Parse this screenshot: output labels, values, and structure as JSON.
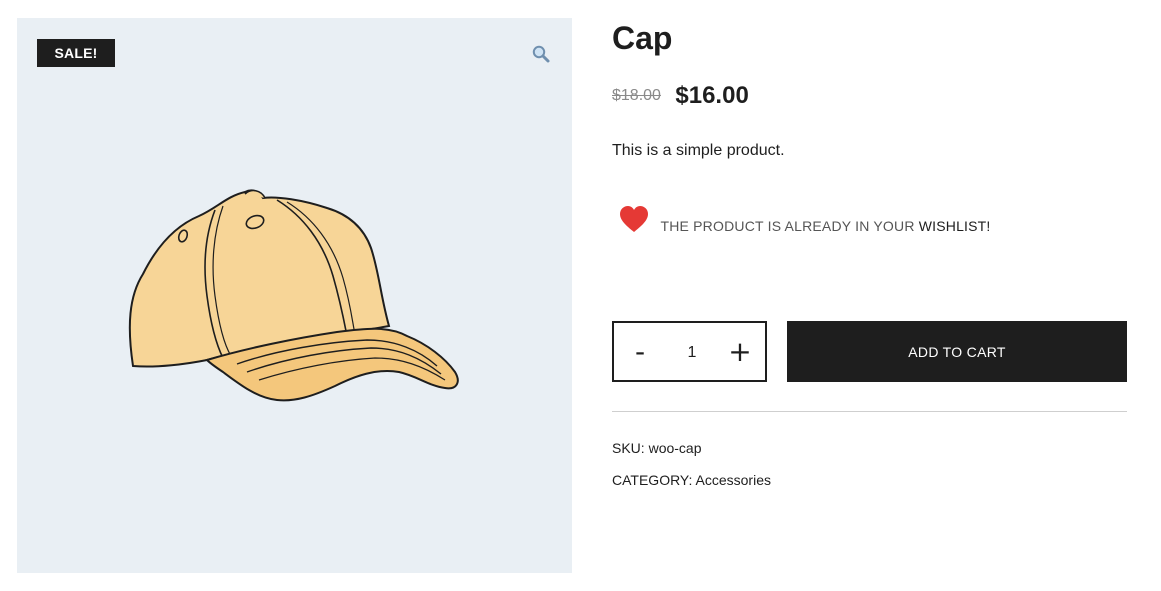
{
  "gallery": {
    "badge": "SALE!",
    "zoom_icon": "magnifier-icon",
    "image_subject": "cap"
  },
  "product": {
    "title": "Cap",
    "price_regular": "$18.00",
    "price_sale": "$16.00",
    "short_description": "This is a simple product."
  },
  "wishlist": {
    "icon": "heart-icon",
    "message": "THE PRODUCT IS ALREADY IN YOUR ",
    "link_label": "WISHLIST!"
  },
  "cart": {
    "minus_label": "-",
    "quantity": "1",
    "plus_label": "+",
    "add_label": "ADD TO CART"
  },
  "meta": {
    "sku_label": "SKU: ",
    "sku_value": "woo-cap",
    "category_label": "CATEGORY: ",
    "category_value": "Accessories"
  },
  "colors": {
    "accent_dark": "#1e1e1e",
    "gallery_bg": "#e9eff4",
    "heart": "#e53935"
  }
}
